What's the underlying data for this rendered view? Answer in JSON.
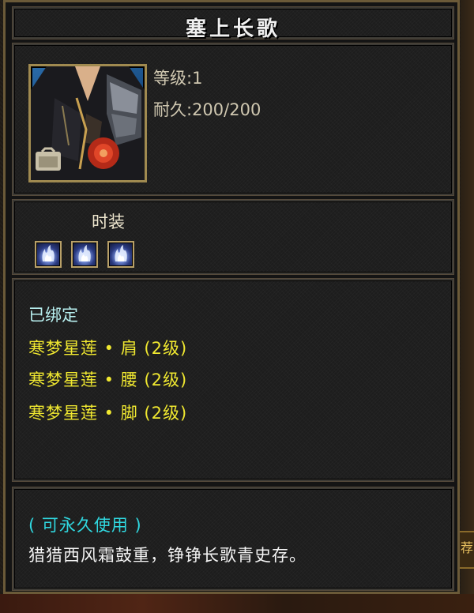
{
  "item": {
    "name": "塞上长歌",
    "level_text": "等级:1",
    "durability_text": "耐久:200/200",
    "icon": "fashion-costume-icon"
  },
  "fashion": {
    "label": "时装",
    "slots": [
      {
        "icon": "blue-flame-gem-icon"
      },
      {
        "icon": "blue-flame-gem-icon"
      },
      {
        "icon": "blue-flame-gem-icon"
      }
    ]
  },
  "attributes": {
    "bound_text": "已绑定",
    "set_lines": [
      "寒梦星莲 • 肩 (2级)",
      "寒梦星莲 • 腰 (2级)",
      "寒梦星莲 • 脚 (2级)"
    ]
  },
  "description": {
    "usage": "( 可永久使用 )",
    "flavor": "猎猎西风霜鼓重，铮铮长歌青史存。"
  },
  "background": {
    "tag_text": "荐"
  },
  "colors": {
    "border_gold": "#6b5a38",
    "bound_cyan": "#b8f0f0",
    "set_yellow": "#f0e830",
    "usage_cyan": "#30d8e0"
  }
}
